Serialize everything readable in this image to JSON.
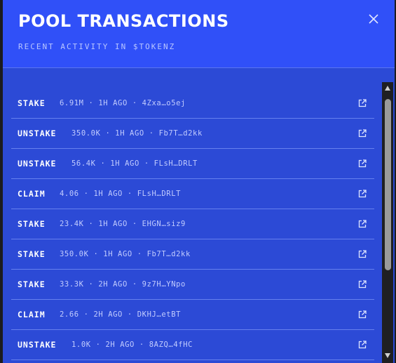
{
  "modal": {
    "title": "POOL TRANSACTIONS",
    "subtitle": "RECENT ACTIVITY IN $TOKENZ",
    "close_icon": "close-icon"
  },
  "transactions": [
    {
      "type": "STAKE",
      "meta": "6.91M · 1H AGO · 4Zxa…o5ej"
    },
    {
      "type": "UNSTAKE",
      "meta": "350.0K · 1H AGO · Fb7T…d2kk"
    },
    {
      "type": "UNSTAKE",
      "meta": "56.4K · 1H AGO · FLsH…DRLT"
    },
    {
      "type": "CLAIM",
      "meta": "4.06 · 1H AGO · FLsH…DRLT"
    },
    {
      "type": "STAKE",
      "meta": "23.4K · 1H AGO · EHGN…siz9"
    },
    {
      "type": "STAKE",
      "meta": "350.0K · 1H AGO · Fb7T…d2kk"
    },
    {
      "type": "STAKE",
      "meta": "33.3K · 2H AGO · 9z7H…YNpo"
    },
    {
      "type": "CLAIM",
      "meta": "2.66 · 2H AGO · DKHJ…etBT"
    },
    {
      "type": "UNSTAKE",
      "meta": "1.0K · 2H AGO · 8AZQ…4fHC"
    }
  ],
  "colors": {
    "header_bg": "#3050f8",
    "list_bg": "#2c4ad6",
    "divider": "#6680ee",
    "text": "#ffffff",
    "muted": "#c2ccff"
  }
}
